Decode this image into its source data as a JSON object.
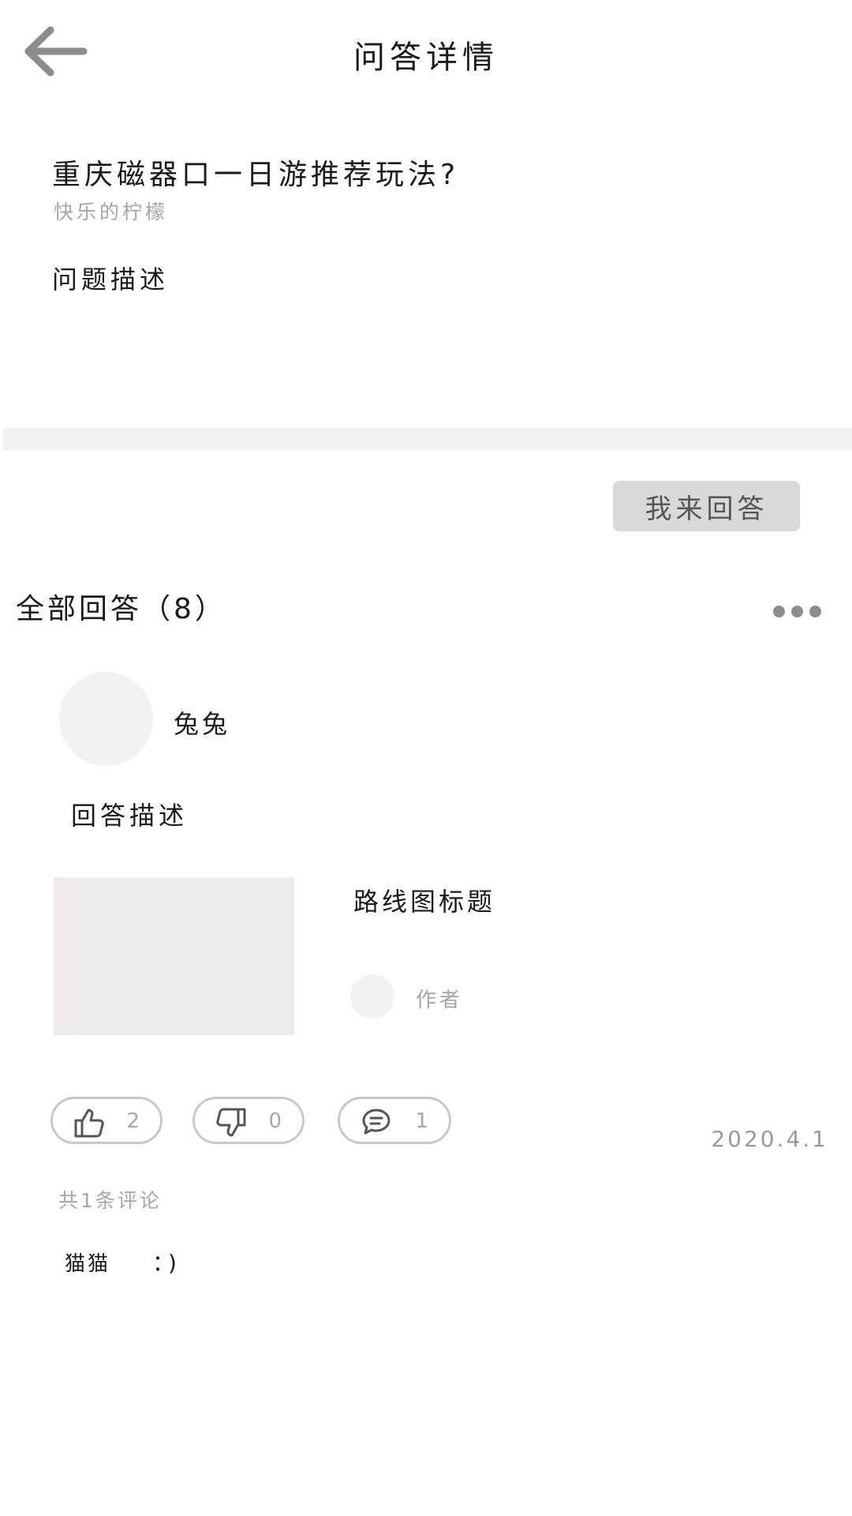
{
  "header": {
    "title": "问答详情",
    "back_icon": "arrow-left-icon"
  },
  "question": {
    "title": "重庆磁器口一日游推荐玩法?",
    "author": "快乐的柠檬",
    "description": "问题描述"
  },
  "answer_button": {
    "label": "我来回答"
  },
  "answers_header": {
    "label": "全部回答（8）",
    "more_icon": "more-dots-icon"
  },
  "answer": {
    "username": "兔兔",
    "description": "回答描述",
    "route_card": {
      "title": "路线图标题",
      "author": "作者"
    },
    "actions": {
      "likes": "2",
      "dislikes": "0",
      "comments": "1"
    },
    "date": "2020.4.1"
  },
  "comments": {
    "total_label": "共1条评论",
    "items": [
      {
        "user": "猫猫",
        "text": "：)"
      }
    ]
  },
  "colors": {
    "divider": "#f2f2f2",
    "button_bg": "#d9d9d9",
    "muted_text": "#a6a6a6",
    "icon_gray": "#999999"
  }
}
